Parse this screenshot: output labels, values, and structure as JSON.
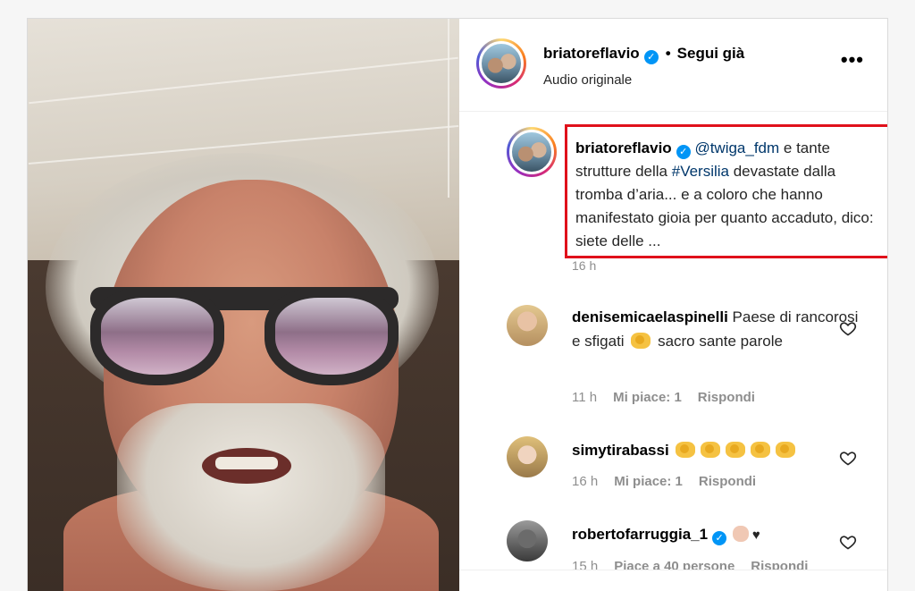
{
  "post": {
    "username": "briatoreflavio",
    "follow_label": "Segui già",
    "audio_label": "Audio originale",
    "more_label": "•••"
  },
  "caption": {
    "username": "briatoreflavio",
    "mention": "@twiga_fdm",
    "text_1": " e tante strutture della ",
    "hashtag": "#Versilia",
    "text_2": " devastate dalla tromba d’aria... e a coloro che hanno manifestato gioia per quanto accaduto, dico: siete delle ...",
    "time": "16 h"
  },
  "comments": [
    {
      "username": "denisemicaelaspinelli",
      "text_1": "Paese di rancorosi e sfigati",
      "emoji": "clapping-hands",
      "text_2": "sacro sante parole",
      "time": "11 h",
      "likes": "Mi piace: 1",
      "reply": "Rispondi"
    },
    {
      "username": "simytirabassi",
      "emoji": "clapping-hands x5",
      "time": "16 h",
      "likes": "Mi piace: 1",
      "reply": "Rispondi"
    },
    {
      "username": "robertofarruggia_1",
      "emoji": "waving-hand + black-heart",
      "heart_char": "♥",
      "time": "15 h",
      "likes": "Piace a 40 persone",
      "reply": "Rispondi"
    }
  ],
  "colors": {
    "highlight_border": "#e0111b",
    "verified": "#0095f6",
    "link": "#00376b",
    "meta": "#8e8e8e"
  }
}
